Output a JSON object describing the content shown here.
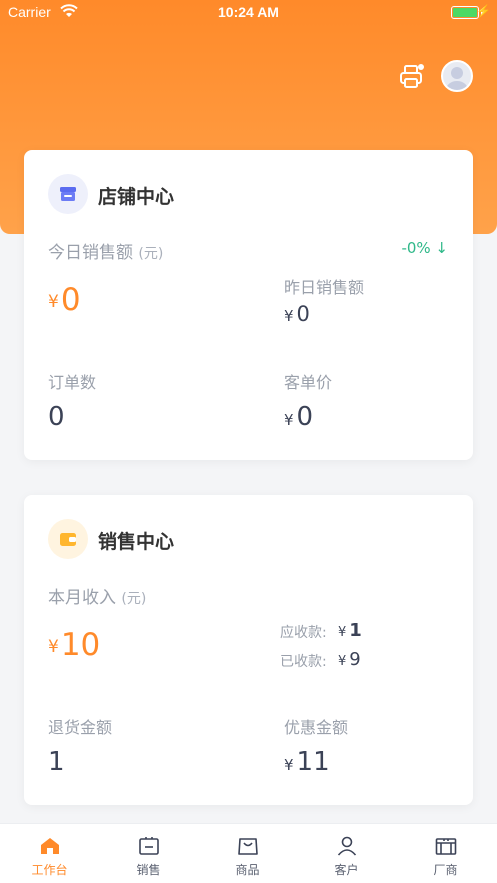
{
  "status_bar": {
    "carrier": "Carrier",
    "time": "10:24 AM"
  },
  "colors": {
    "accent": "#ff8a2a",
    "positive": "#2fb889",
    "text_dark": "#3b4256"
  },
  "store_center": {
    "title": "店铺中心",
    "today_sales_label": "今日销售额",
    "today_sales_unit": "(元)",
    "change": "-0% ↓",
    "today_sales_currency": "¥",
    "today_sales_value": "0",
    "yesterday_label": "昨日销售额",
    "yesterday_currency": "¥",
    "yesterday_value": "0",
    "orders_label": "订单数",
    "orders_value": "0",
    "avg_price_label": "客单价",
    "avg_price_currency": "¥",
    "avg_price_value": "0"
  },
  "sales_center": {
    "title": "销售中心",
    "month_income_label": "本月收入",
    "month_income_unit": "(元)",
    "month_income_currency": "¥",
    "month_income_value": "10",
    "receivable_label": "应收款:",
    "receivable_currency": "¥",
    "receivable_value": "1",
    "received_label": "已收款:",
    "received_currency": "¥",
    "received_value": "9",
    "refund_label": "退货金额",
    "refund_value": "1",
    "discount_label": "优惠金额",
    "discount_currency": "¥",
    "discount_value": "11"
  },
  "tabbar": {
    "items": [
      {
        "label": "工作台",
        "icon": "home-icon",
        "active": true
      },
      {
        "label": "销售",
        "icon": "sales-icon",
        "active": false
      },
      {
        "label": "商品",
        "icon": "bag-icon",
        "active": false
      },
      {
        "label": "客户",
        "icon": "user-icon",
        "active": false
      },
      {
        "label": "厂商",
        "icon": "factory-icon",
        "active": false
      }
    ]
  }
}
